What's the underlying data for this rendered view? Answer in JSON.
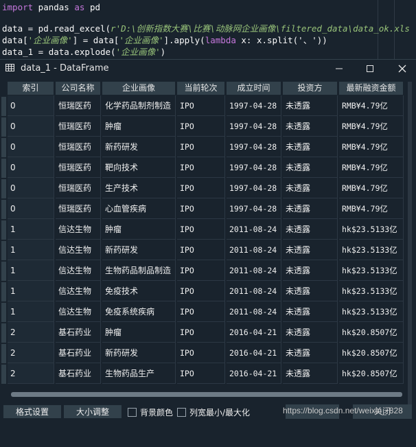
{
  "editor": {
    "lines": [
      {
        "parts": [
          [
            "kw",
            "import"
          ],
          [
            "id",
            " pandas "
          ],
          [
            "kw",
            "as"
          ],
          [
            "id",
            " pd"
          ]
        ]
      },
      {
        "parts": [
          [
            "id",
            ""
          ]
        ]
      },
      {
        "parts": [
          [
            "id",
            "data = pd.read_excel("
          ],
          [
            "str",
            "r'D:\\创新指数大赛\\比赛\\动脉网企业画像\\filtered_data\\data_ok.xls"
          ]
        ]
      },
      {
        "parts": [
          [
            "id",
            "data["
          ],
          [
            "str",
            "'企业画像'"
          ],
          [
            "id",
            "] = data["
          ],
          [
            "str",
            "'企业画像'"
          ],
          [
            "id",
            "].apply("
          ],
          [
            "kw",
            "lambda"
          ],
          [
            "id",
            " x: x.split('、'))"
          ]
        ]
      },
      {
        "parts": [
          [
            "id",
            "data_1 = data.explode("
          ],
          [
            "str",
            "'企业画像'"
          ],
          [
            "id",
            ")"
          ]
        ]
      }
    ]
  },
  "window": {
    "title": "data_1 - DataFrame",
    "minimize_icon": "minimize-icon",
    "maximize_icon": "maximize-icon",
    "close_icon": "close-icon"
  },
  "table": {
    "columns": [
      "索引",
      "公司名称",
      "企业画像",
      "当前轮次",
      "成立时间",
      "投资方",
      "最新融资金额"
    ],
    "rows": [
      [
        "0",
        "恒瑞医药",
        "化学药品制剂制造",
        "IPO",
        "1997-04-28",
        "未透露",
        "RMB¥4.79亿"
      ],
      [
        "0",
        "恒瑞医药",
        "肿瘤",
        "IPO",
        "1997-04-28",
        "未透露",
        "RMB¥4.79亿"
      ],
      [
        "0",
        "恒瑞医药",
        "新药研发",
        "IPO",
        "1997-04-28",
        "未透露",
        "RMB¥4.79亿"
      ],
      [
        "0",
        "恒瑞医药",
        "靶向技术",
        "IPO",
        "1997-04-28",
        "未透露",
        "RMB¥4.79亿"
      ],
      [
        "0",
        "恒瑞医药",
        "生产技术",
        "IPO",
        "1997-04-28",
        "未透露",
        "RMB¥4.79亿"
      ],
      [
        "0",
        "恒瑞医药",
        "心血管疾病",
        "IPO",
        "1997-04-28",
        "未透露",
        "RMB¥4.79亿"
      ],
      [
        "1",
        "信达生物",
        "肿瘤",
        "IPO",
        "2011-08-24",
        "未透露",
        "hk$23.5133亿"
      ],
      [
        "1",
        "信达生物",
        "新药研发",
        "IPO",
        "2011-08-24",
        "未透露",
        "hk$23.5133亿"
      ],
      [
        "1",
        "信达生物",
        "生物药品制品制造",
        "IPO",
        "2011-08-24",
        "未透露",
        "hk$23.5133亿"
      ],
      [
        "1",
        "信达生物",
        "免疫技术",
        "IPO",
        "2011-08-24",
        "未透露",
        "hk$23.5133亿"
      ],
      [
        "1",
        "信达生物",
        "免疫系统疾病",
        "IPO",
        "2011-08-24",
        "未透露",
        "hk$23.5133亿"
      ],
      [
        "2",
        "基石药业",
        "肿瘤",
        "IPO",
        "2016-04-21",
        "未透露",
        "hk$20.8507亿"
      ],
      [
        "2",
        "基石药业",
        "新药研发",
        "IPO",
        "2016-04-21",
        "未透露",
        "hk$20.8507亿"
      ],
      [
        "2",
        "基石药业",
        "生物药品生产",
        "IPO",
        "2016-04-21",
        "未透露",
        "hk$20.8507亿"
      ]
    ]
  },
  "bottombar": {
    "format_button": "格式设置",
    "resize_button": "大小调整",
    "bg_color_label": "背景颜色",
    "col_width_label": "列宽最小/最大化",
    "watermark": "https://blog.csdn.net/weixin_",
    "watermark_num": "828",
    "close_button": "关闭"
  },
  "colors": {
    "background": "#19232d",
    "header": "#32414b",
    "keyword": "#c678dd",
    "string": "#98c379"
  }
}
